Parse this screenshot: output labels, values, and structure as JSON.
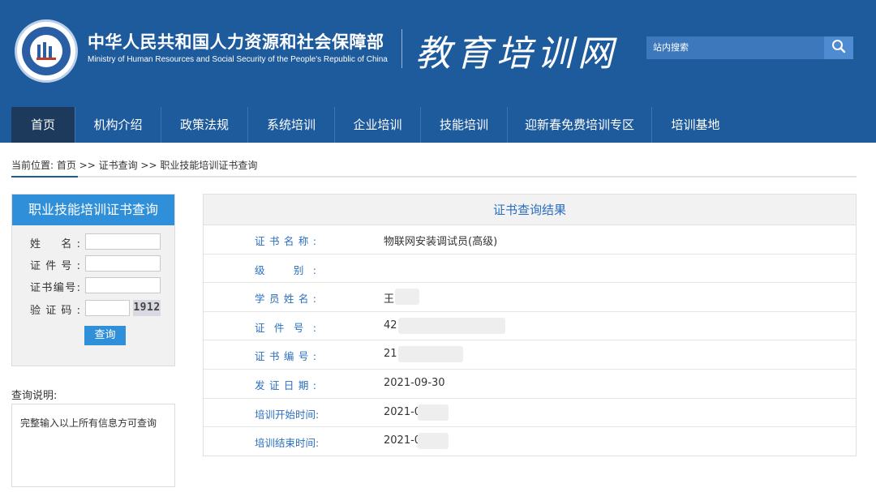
{
  "header": {
    "org_name_cn": "中华人民共和国人力资源和社会保障部",
    "org_name_en": "Ministry of Human Resources and Social Security of the People's Republic of China",
    "site_name": "教育培训网",
    "search_placeholder": "站内搜索",
    "search_icon": "search-icon",
    "colors": {
      "header_bg": "#1e5b9d",
      "nav_active_bg": "#1d3a5c",
      "accent": "#2f8fd8"
    }
  },
  "nav": {
    "items": [
      {
        "label": "首页",
        "active": true
      },
      {
        "label": "机构介绍"
      },
      {
        "label": "政策法规"
      },
      {
        "label": "系统培训"
      },
      {
        "label": "企业培训"
      },
      {
        "label": "技能培训"
      },
      {
        "label": "迎新春免费培训专区"
      },
      {
        "label": "培训基地"
      }
    ]
  },
  "breadcrumb": {
    "text": "当前位置: 首页 >> 证书查询 >> 职业技能培训证书查询"
  },
  "query": {
    "title": "职业技能培训证书查询",
    "fields": [
      {
        "label": "姓　名:",
        "value": ""
      },
      {
        "label": "证件号:",
        "value": ""
      },
      {
        "label": "证书编号:",
        "value": ""
      },
      {
        "label": "验证码:",
        "value": ""
      }
    ],
    "captcha": "1912",
    "submit_label": "查询"
  },
  "note": {
    "title": "查询说明:",
    "text": "完整输入以上所有信息方可查询"
  },
  "result": {
    "title": "证书查询结果",
    "rows": [
      {
        "label": "证书名称:",
        "value": "物联网安装调试员(高级)"
      },
      {
        "label": "级　别:",
        "value": ""
      },
      {
        "label": "学员姓名:",
        "value": "王"
      },
      {
        "label": "证件号:",
        "value": "42"
      },
      {
        "label": "证书编号:",
        "value": "21"
      },
      {
        "label": "发证日期:",
        "value": "2021-09-30"
      },
      {
        "label": "培训开始时间:",
        "value": "2021-0"
      },
      {
        "label": "培训结束时间:",
        "value": "2021-0"
      }
    ]
  }
}
